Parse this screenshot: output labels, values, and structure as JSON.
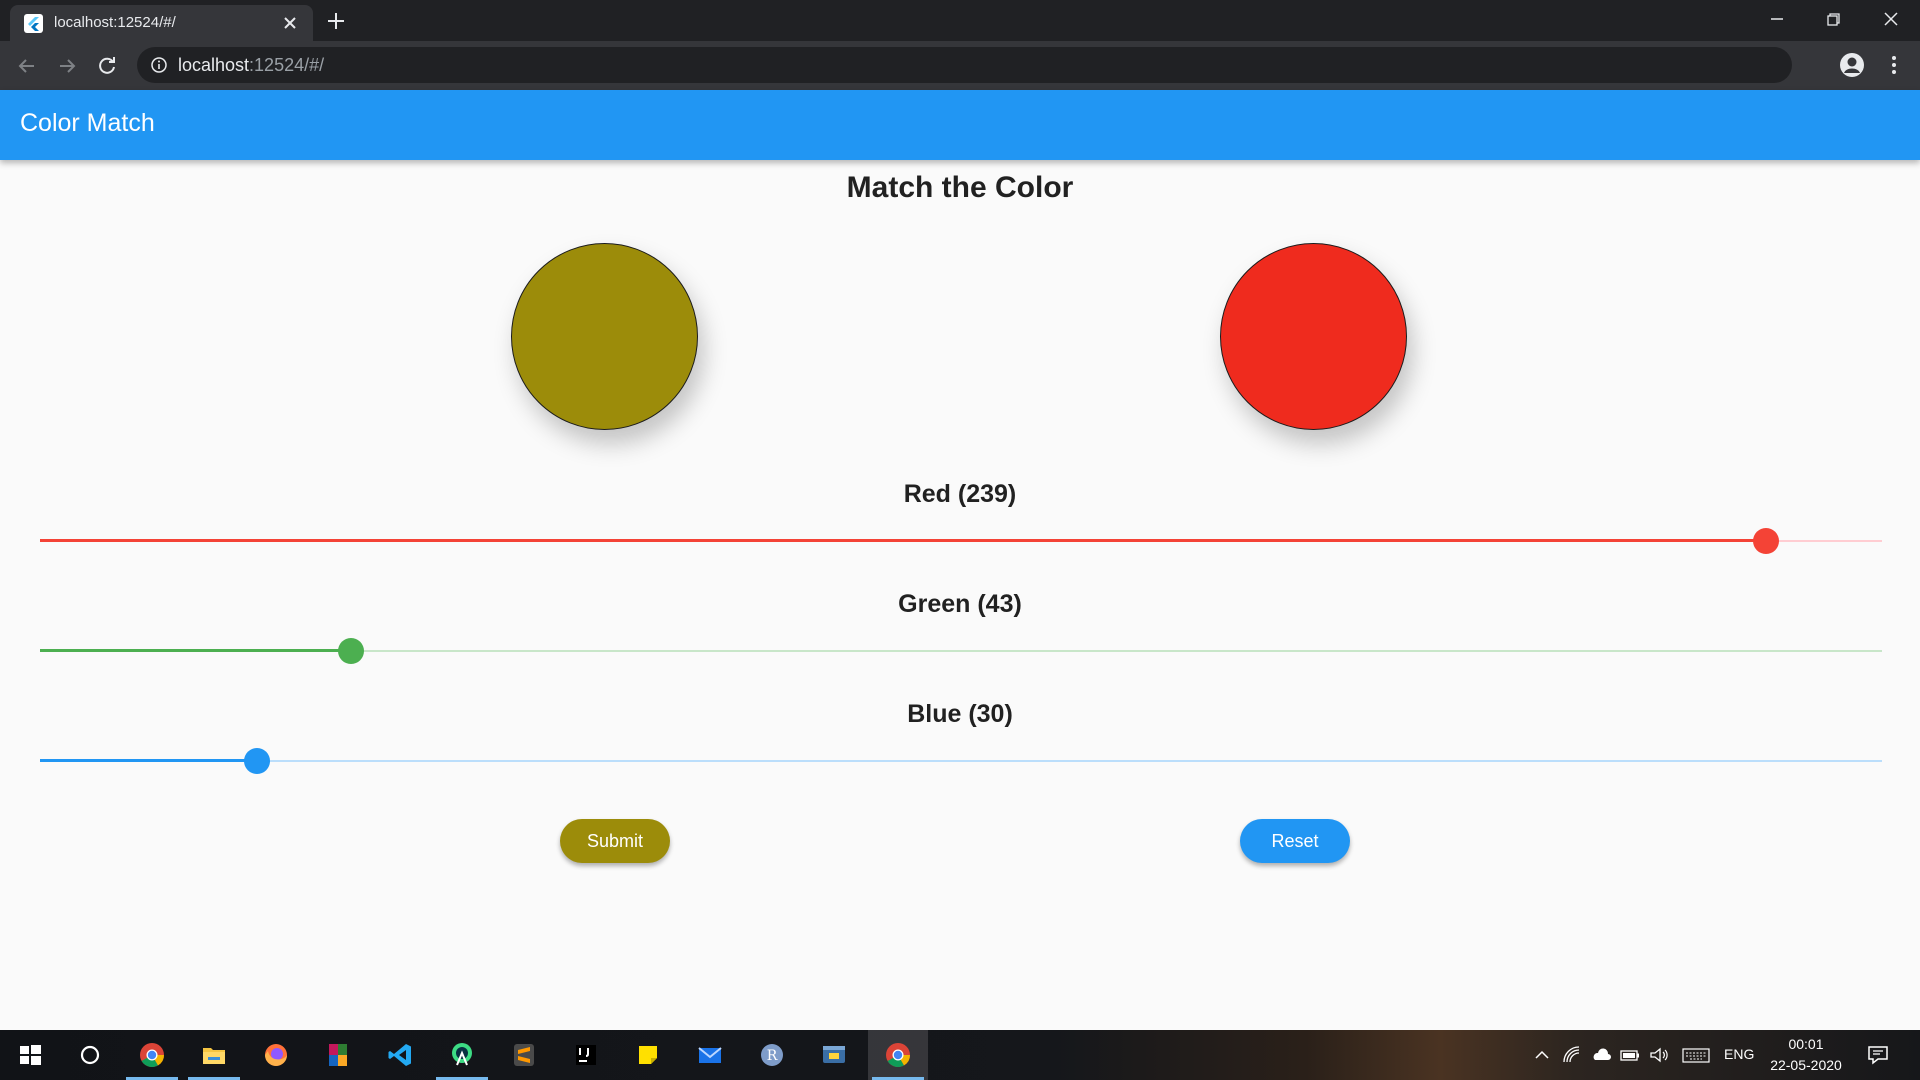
{
  "browser": {
    "tab_title": "localhost:12524/#/",
    "url_host": "localhost",
    "url_rest": ":12524/#/",
    "icons": [
      "flutter-icon",
      "close-icon",
      "plus-icon",
      "minimize-icon",
      "restore-icon",
      "close-icon",
      "back-icon",
      "forward-icon",
      "reload-icon",
      "info-icon",
      "star-icon",
      "account-icon",
      "more-icon"
    ]
  },
  "app": {
    "title": "Color Match",
    "accent_color": "#2196f3",
    "heading": "Match the Color",
    "target_color": "#9c8c0a",
    "user_color": "#ef2b1e",
    "sliders": [
      {
        "label": "Red (239)",
        "value": 239,
        "max": 255,
        "color": "#f44336",
        "track_color": "#ffcdd2"
      },
      {
        "label": "Green (43)",
        "value": 43,
        "max": 255,
        "color": "#4caf50",
        "track_color": "#c8e6c9"
      },
      {
        "label": "Blue (30)",
        "value": 30,
        "max": 255,
        "color": "#2196f3",
        "track_color": "#bbdefb"
      }
    ],
    "submit_label": "Submit",
    "reset_label": "Reset"
  },
  "taskbar": {
    "apps": [
      "windows-start-icon",
      "cortana-search-icon",
      "chrome-icon",
      "file-explorer-icon",
      "firefox-icon",
      "winrar-icon",
      "vscode-icon",
      "android-studio-icon",
      "sublime-text-icon",
      "intellij-icon",
      "sticky-notes-icon",
      "mail-icon",
      "r-icon",
      "python-icon",
      "chrome-active-icon"
    ],
    "language": "ENG",
    "time": "00:01",
    "date": "22-05-2020"
  }
}
